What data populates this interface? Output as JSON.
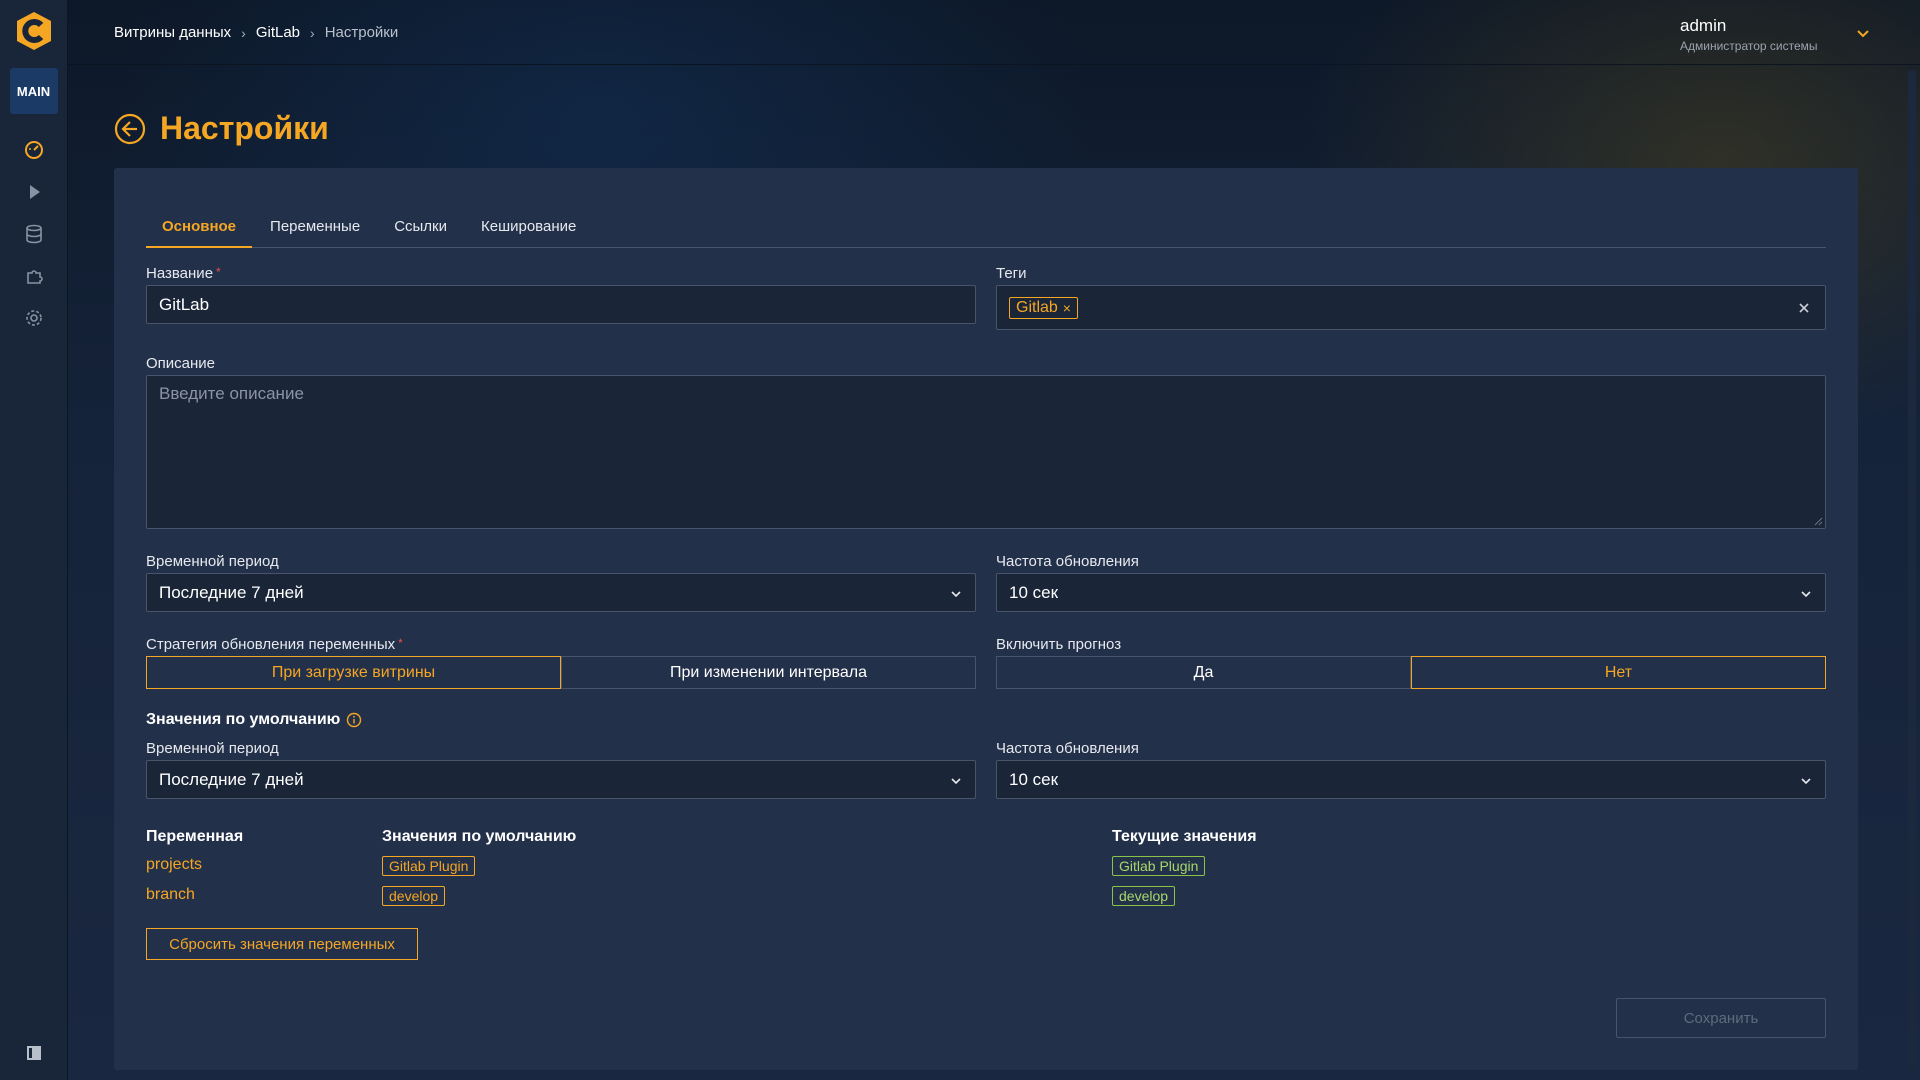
{
  "sidebar": {
    "badge": "MAIN",
    "icons": [
      "dashboard-icon",
      "play-icon",
      "database-icon",
      "plugin-icon",
      "gear-icon"
    ],
    "bottom_icon": "panel-toggle-icon"
  },
  "header": {
    "breadcrumb": [
      "Витрины данных",
      "GitLab",
      "Настройки"
    ],
    "user_name": "admin",
    "user_role": "Администратор системы"
  },
  "page": {
    "title": "Настройки"
  },
  "tabs": [
    "Основное",
    "Переменные",
    "Ссылки",
    "Кеширование"
  ],
  "form": {
    "name_label": "Название",
    "name_value": "GitLab",
    "tags_label": "Теги",
    "tags": [
      "Gitlab"
    ],
    "description_label": "Описание",
    "description_placeholder": "Введите описание",
    "period_label": "Временной период",
    "period_value": "Последние 7 дней",
    "refresh_label": "Частота обновления",
    "refresh_value": "10 сек",
    "strategy_label": "Стратегия обновления переменных",
    "strategy_options": [
      "При загрузке витрины",
      "При изменении интервала"
    ],
    "strategy_selected": "При загрузке витрины",
    "forecast_label": "Включить прогноз",
    "forecast_options": [
      "Да",
      "Нет"
    ],
    "forecast_selected": "Нет"
  },
  "defaults": {
    "section_title": "Значения по умолчанию",
    "period_label": "Временной период",
    "period_value": "Последние 7 дней",
    "refresh_label": "Частота обновления",
    "refresh_value": "10 сек"
  },
  "variables": {
    "headers": [
      "Переменная",
      "Значения по умолчанию",
      "Текущие значения"
    ],
    "rows": [
      {
        "name": "projects",
        "default": "Gitlab Plugin",
        "current": "Gitlab Plugin"
      },
      {
        "name": "branch",
        "default": "develop",
        "current": "develop"
      }
    ],
    "reset_label": "Сбросить значения переменных"
  },
  "actions": {
    "save_label": "Сохранить"
  },
  "colors": {
    "accent": "#f5a623",
    "success": "#8bc34a",
    "required": "#e8504a"
  }
}
